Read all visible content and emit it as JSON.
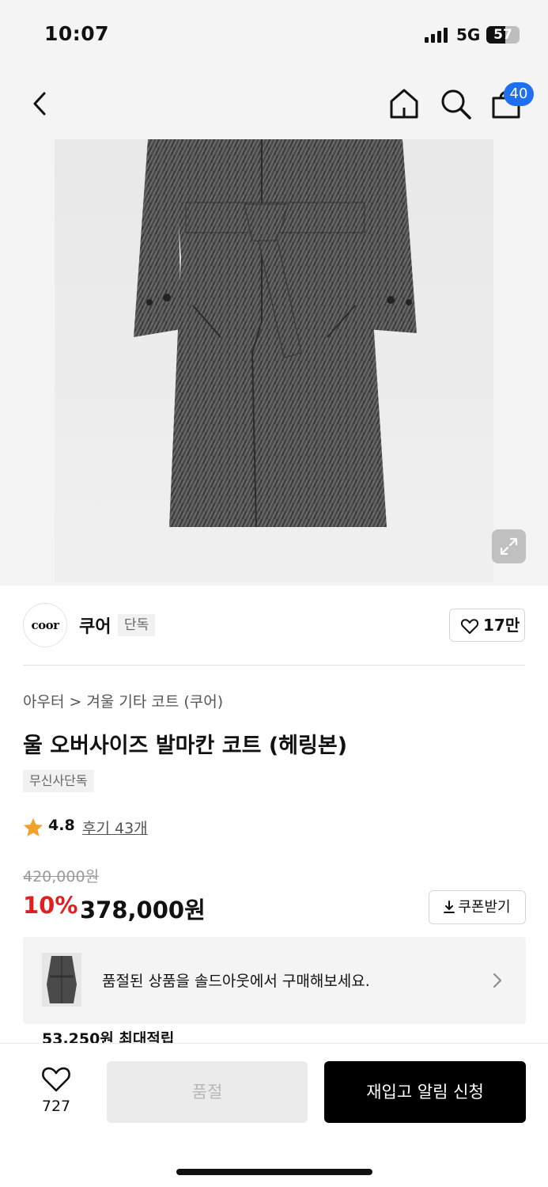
{
  "status_bar": {
    "time": "10:07",
    "network": "5G",
    "battery": "57",
    "battery_level": 0.57
  },
  "nav": {
    "back_icon": "chevron-left-icon",
    "home_icon": "home-icon",
    "search_icon": "search-icon",
    "cart_icon": "shopping-bag-icon",
    "cart_count": "40"
  },
  "hero": {
    "expand_icon": "expand-icon"
  },
  "brand": {
    "logo_text": "coor",
    "name": "쿠어",
    "tag": "단독",
    "like_count": "17만"
  },
  "product": {
    "breadcrumb": [
      "아우터",
      "겨울 기타 코트 (쿠어)"
    ],
    "title": "울 오버사이즈 발마칸 코트 (헤링본)",
    "exclusive_tag": "무신사단독",
    "rating": "4.8",
    "reviews": "후기 43개",
    "original_price": "420,000원",
    "discount": "10%",
    "price": "378,000원",
    "coupon_label": "쿠폰받기"
  },
  "soldout_banner": {
    "text": "품절된 상품을 솔드아웃에서 구매해보세요."
  },
  "points": {
    "text": "53,250원 최대적립"
  },
  "bottom_bar": {
    "wish_count": "727",
    "soldout_label": "품절",
    "restock_label": "재입고 알림 신청"
  },
  "colors": {
    "accent": "#1e6ff2",
    "discount": "#e02020",
    "star": "#f2a12a"
  }
}
